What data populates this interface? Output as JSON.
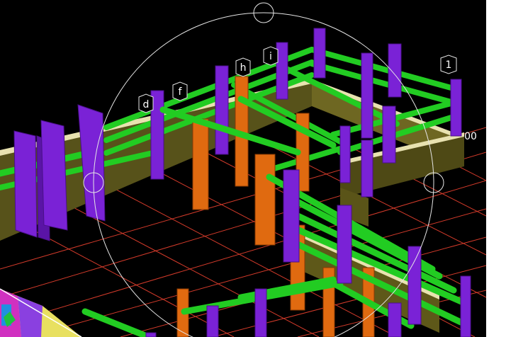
{
  "viewport": {
    "bubbles": [
      "d",
      "f",
      "h",
      "i",
      "1"
    ],
    "dimension_partial": "00"
  },
  "colors": {
    "background": "#000000",
    "grid": "#d23a2a",
    "beam": "#22cc22",
    "column_purple": "#7a22d6",
    "column_orange": "#e06a10",
    "wall_olive": "#5a5418",
    "wall_top": "#e8e2b0",
    "orbit": "#e0e0e0"
  },
  "icons": [
    "orbit-handle",
    "view-cube"
  ]
}
